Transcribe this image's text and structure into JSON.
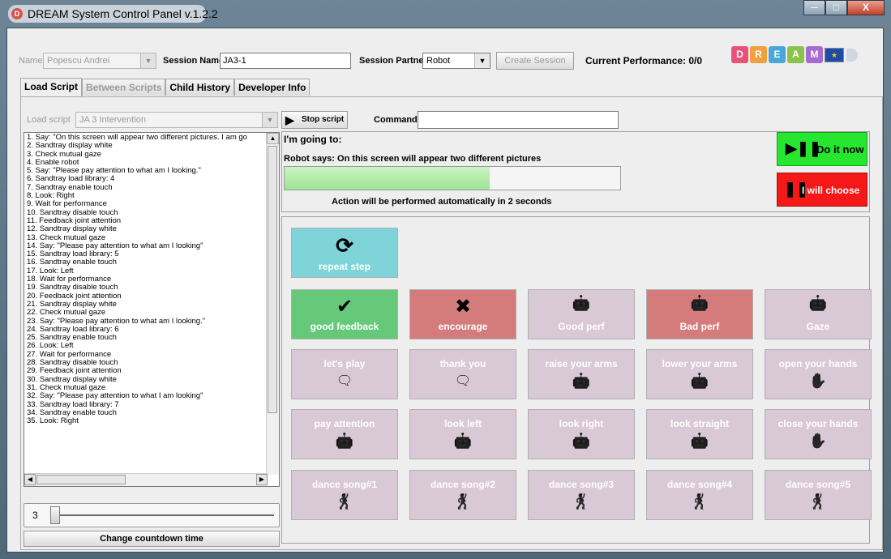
{
  "window": {
    "title": "DREAM System Control Panel v.1.2.2"
  },
  "session": {
    "name_label": "Name",
    "name_value": "Popescu Andrei",
    "session_name_label": "Session Name",
    "session_name_value": "JA3-1",
    "partner_label": "Session Partner",
    "partner_value": "Robot",
    "create_label": "Create Session",
    "performance": "Current Performance: 0/0"
  },
  "logo": {
    "letters": [
      "D",
      "R",
      "E",
      "A",
      "M"
    ],
    "colors": [
      "#e9507a",
      "#f2a03d",
      "#4aa6d8",
      "#8bc34a",
      "#a66bd0"
    ]
  },
  "tabs": [
    {
      "label": "Load Script",
      "state": "active"
    },
    {
      "label": "Between Scripts",
      "state": "disabled"
    },
    {
      "label": "Child History",
      "state": "normal"
    },
    {
      "label": "Developer Info",
      "state": "normal"
    }
  ],
  "script": {
    "load_label": "Load script",
    "selected": "JA 3 Intervention",
    "stop_label": "Stop script",
    "command_label": "Command",
    "command_value": "",
    "items": [
      "1. Say: \"On this screen will appear two different pictures. I am go",
      "2. Sandtray display white",
      "3. Check mutual gaze",
      "4. Enable robot",
      "5. Say: \"Please pay attention to what am I looking.\"",
      "6. Sandtray load library: 4",
      "7. Sandtray enable touch",
      "8. Look: Right",
      "9. Wait for performance",
      "10. Sandtray disable touch",
      "11. Feedback joint attention",
      "12. Sandtray display white",
      "13. Check mutual gaze",
      "14. Say: \"Please pay attention to what am I looking\"",
      "15. Sandtray load library: 5",
      "16. Sandtray enable touch",
      "17. Look: Left",
      "18. Wait for performance",
      "19. Sandtray disable touch",
      "20. Feedback joint attention",
      "21. Sandtray display white",
      "22. Check mutual gaze",
      "23. Say: \"Please pay attention to what am I looking.\"",
      "24. Sandtray load library: 6",
      "25. Sandtray enable touch",
      "26. Look: Left",
      "27. Wait for performance",
      "28. Sandtray disable touch",
      "29. Feedback joint attention",
      "30. Sandtray display white",
      "31. Check mutual gaze",
      "32. Say: \"Please pay attention to what I am looking\"",
      "33. Sandtray load library: 7",
      "34. Sandtray enable touch",
      "35. Look: Right"
    ]
  },
  "countdown": {
    "value": "3",
    "change_label": "Change countdown time"
  },
  "going": {
    "heading": "I'm going to:",
    "robot_says": "Robot says: On this screen will appear two different pictures",
    "progress_fraction": 0.61,
    "auto_text": "Action will be performed automatically in 2 seconds",
    "do_it_label": "Do it now",
    "choose_label": "I will choose"
  },
  "actions": {
    "repeat": "repeat step",
    "row1": [
      {
        "label": "good feedback",
        "icon": "check-icon",
        "color": "grn"
      },
      {
        "label": "encourage",
        "icon": "x-icon",
        "color": "red"
      },
      {
        "label": "Good perf",
        "icon": "robot-icon",
        "color": "lav"
      },
      {
        "label": "Bad perf",
        "icon": "robot-icon",
        "color": "red"
      },
      {
        "label": "Gaze",
        "icon": "robot-icon",
        "color": "lav"
      }
    ],
    "row2": [
      {
        "label": "let's play",
        "icon": "speech-bubble-icon"
      },
      {
        "label": "thank you",
        "icon": "speech-bubble-icon"
      },
      {
        "label": "raise your arms",
        "icon": "robot-icon"
      },
      {
        "label": "lower your arms",
        "icon": "robot-icon"
      },
      {
        "label": "open your hands",
        "icon": "hand-icon"
      }
    ],
    "row3": [
      {
        "label": "pay attention",
        "icon": "robot-icon"
      },
      {
        "label": "look left",
        "icon": "robot-icon"
      },
      {
        "label": "look right",
        "icon": "robot-icon"
      },
      {
        "label": "look straight",
        "icon": "robot-icon"
      },
      {
        "label": "close your hands",
        "icon": "hand-icon"
      }
    ],
    "row4": [
      {
        "label": "dance song#1",
        "icon": "dancer-icon"
      },
      {
        "label": "dance song#2",
        "icon": "dancer-icon"
      },
      {
        "label": "dance song#3",
        "icon": "dancer-icon"
      },
      {
        "label": "dance song#4",
        "icon": "dancer-icon"
      },
      {
        "label": "dance song#5",
        "icon": "dancer-icon"
      }
    ]
  }
}
